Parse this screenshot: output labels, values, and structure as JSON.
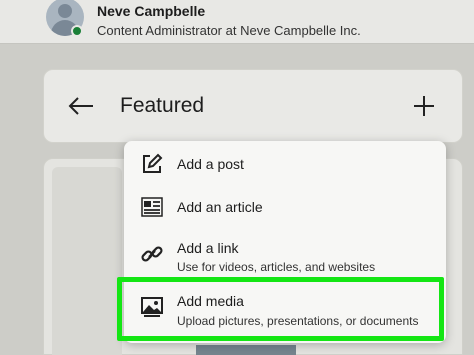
{
  "profile": {
    "name": "Neve Campbelle",
    "title": "Content Administrator at Neve Campbelle Inc."
  },
  "featured": {
    "title": "Featured"
  },
  "menu": {
    "items": [
      {
        "label": "Add a post",
        "icon": "edit-icon"
      },
      {
        "label": "Add an article",
        "icon": "article-icon"
      },
      {
        "label": "Add a link",
        "subtitle": "Use for videos, articles, and websites",
        "icon": "link-icon"
      },
      {
        "label": "Add media",
        "subtitle": "Upload pictures, presentations, or documents",
        "icon": "image-icon"
      }
    ]
  },
  "colors": {
    "highlight": "#14e614",
    "presence": "#1a7f37"
  }
}
